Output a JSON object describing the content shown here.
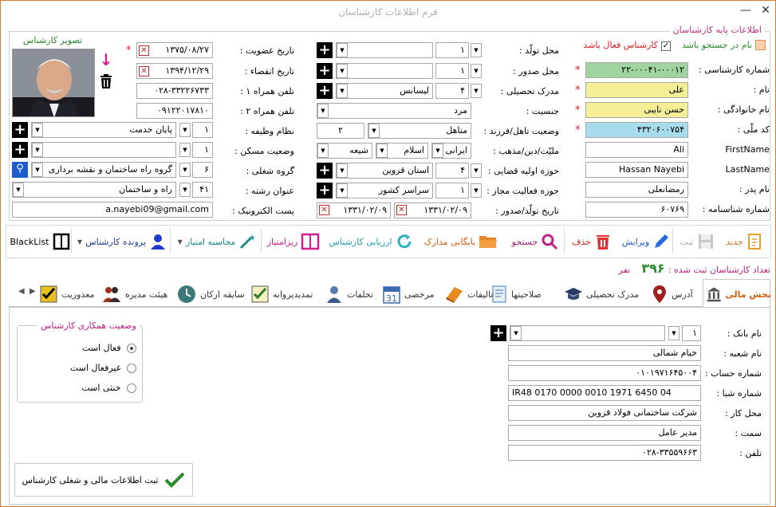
{
  "window": {
    "title": "فرم اطلاعات کارشناسان",
    "minimize": "—",
    "close": "✕"
  },
  "basic": {
    "group_label": "اطلاعات پایه کارشناسان",
    "search_name_label": "نام در جستجو باشد",
    "active_label": "کارشناس فعال باشد",
    "photo_label": "تصویر کارشناس",
    "expert_no_label": "شماره کارشناسی :",
    "expert_no": "۲۲-۰۰۰۴۱-۰۰۰۱۲",
    "name_label": "نام :",
    "name": "علی",
    "family_label": "نام خانوادگی :",
    "family": "حسن نایبی",
    "national_code_label": "کد ملّی :",
    "national_code": "۴۳۲۰۶۰۰۷۵۴",
    "firstname_label": "FirstName",
    "firstname": "Ali",
    "lastname_label": "LastName",
    "lastname": "Hassan  Nayebi",
    "father_label": "نام پدر :",
    "father": "رمضانعلی",
    "id_no_label": "شماره شناسنامه :",
    "id_no": "۶۰۷۶۹",
    "birth_place_label": "محل تولّد :",
    "birth_place_code": "۱",
    "issue_place_label": "محل صدور :",
    "issue_place_code": "۱",
    "degree_label": "مدرک تحصیلی :",
    "degree_code": "۴",
    "degree": "لیسانس",
    "gender_label": "جنسیت :",
    "gender": "مرد",
    "marital_label": "وضعیت تاهل/فرزند :",
    "marital": "متاهل",
    "children": "۲",
    "nationality_label": "ملیّت/دین/مذهب :",
    "nationality": "ایرانی",
    "religion": "اسلام",
    "sect": "شیعه",
    "jurisdiction_label": "حوزه اولیه قضایی :",
    "jurisdiction_code": "۴",
    "jurisdiction": "استان قزوین",
    "activity_label": "حوزه فعالیت مجاز :",
    "activity_code": "۱",
    "activity": "سراسر کشور",
    "birth_date_label": "تاریخ تولّد/صدور :",
    "birth_date": "۱۳۳۱/۰۲/۰۹",
    "issue_date": "۱۳۳۱/۰۲/۰۹",
    "member_date_label": "تاریخ عضویت :",
    "member_date": "۱۳۷۵/۰۸/۲۷",
    "expire_date_label": "تاریخ انقضاء :",
    "expire_date": "۱۳۹۴/۱۲/۲۹",
    "mobile1_label": "تلفن همراه ۱ :",
    "mobile1": "۰۲۸-۳۳۲۲۶۷۳۳",
    "mobile2_label": "تلفن همراه ۲ :",
    "mobile2": "۰۹۱۲۲۰۱۷۸۱۰",
    "duty_label": "نظام وظیفه :",
    "duty_code": "۱",
    "duty": "پایان خدمت",
    "housing_label": "وضعیت مسکن :",
    "housing_code": "۱",
    "job_group_label": "گروه شغلی :",
    "job_group_code": "۶",
    "job_group": "گروه راه ساختمان و نقشه برداری",
    "field_label": "عنوان رشته :",
    "field_code": "۴۱",
    "field": "راه و ساختمان",
    "email_label": "پست الکترونیک :",
    "email": "a.nayebi09@gmail.com"
  },
  "toolbar": {
    "new": "جدید",
    "save": "ثبت",
    "edit": "ویرایش",
    "delete": "حذف",
    "search": "جستجو",
    "archive": "بایگانی مدارک",
    "evaluate": "ارزیابی کارشناس",
    "points": "ریزامتیاز",
    "calc": "محاسبه امتیاز",
    "file": "پرونده کارشناس",
    "blacklist": "BlackList"
  },
  "count": {
    "label": "تعداد کارشناسان ثبت شده :",
    "value": "۳۹۶",
    "unit": "نفر"
  },
  "tabs": [
    "بخش مالی",
    "آدرس",
    "مدرک تحصیلی",
    "صلاحیتها",
    "تالیفات",
    "مرخصی",
    "تخلفات",
    "تمدیدپروانه",
    "سابقه ارکان",
    "هیئت مدیره",
    "معذوریت"
  ],
  "finance": {
    "bank_label": "نام بانک :",
    "bank_code": "۱",
    "branch_label": "نام شعبه :",
    "branch": "خیام شمالی",
    "account_label": "شماره حساب :",
    "account": "۰۱۰۱۹۷۱۶۴۵۰۰۴",
    "sheba_label": "شماره شبا :",
    "sheba": "IR48 0170 0000 0010 1971 6450 04",
    "work_label": "محل کار :",
    "work": "شرکت ساختمانی فولاد قزوین",
    "position_label": "سمت :",
    "position": "مدیر عامل",
    "phone_label": "تلفن :",
    "phone": "۰۲۸-۳۳۵۵۹۶۶۳",
    "coop_label": "وضعیت همکاری کارشناس",
    "coop_options": [
      "فعال است",
      "غیرفعال است",
      "خنثی است"
    ],
    "submit": "ثبت اطلاعات مالی و شغلی کارشناس"
  },
  "colors": {
    "accent": "#e07a30",
    "label_pink": "#c0307a",
    "green_field": "#9fd39f",
    "yellow_field": "#f4ee96",
    "cyan_field": "#a6dcec"
  }
}
